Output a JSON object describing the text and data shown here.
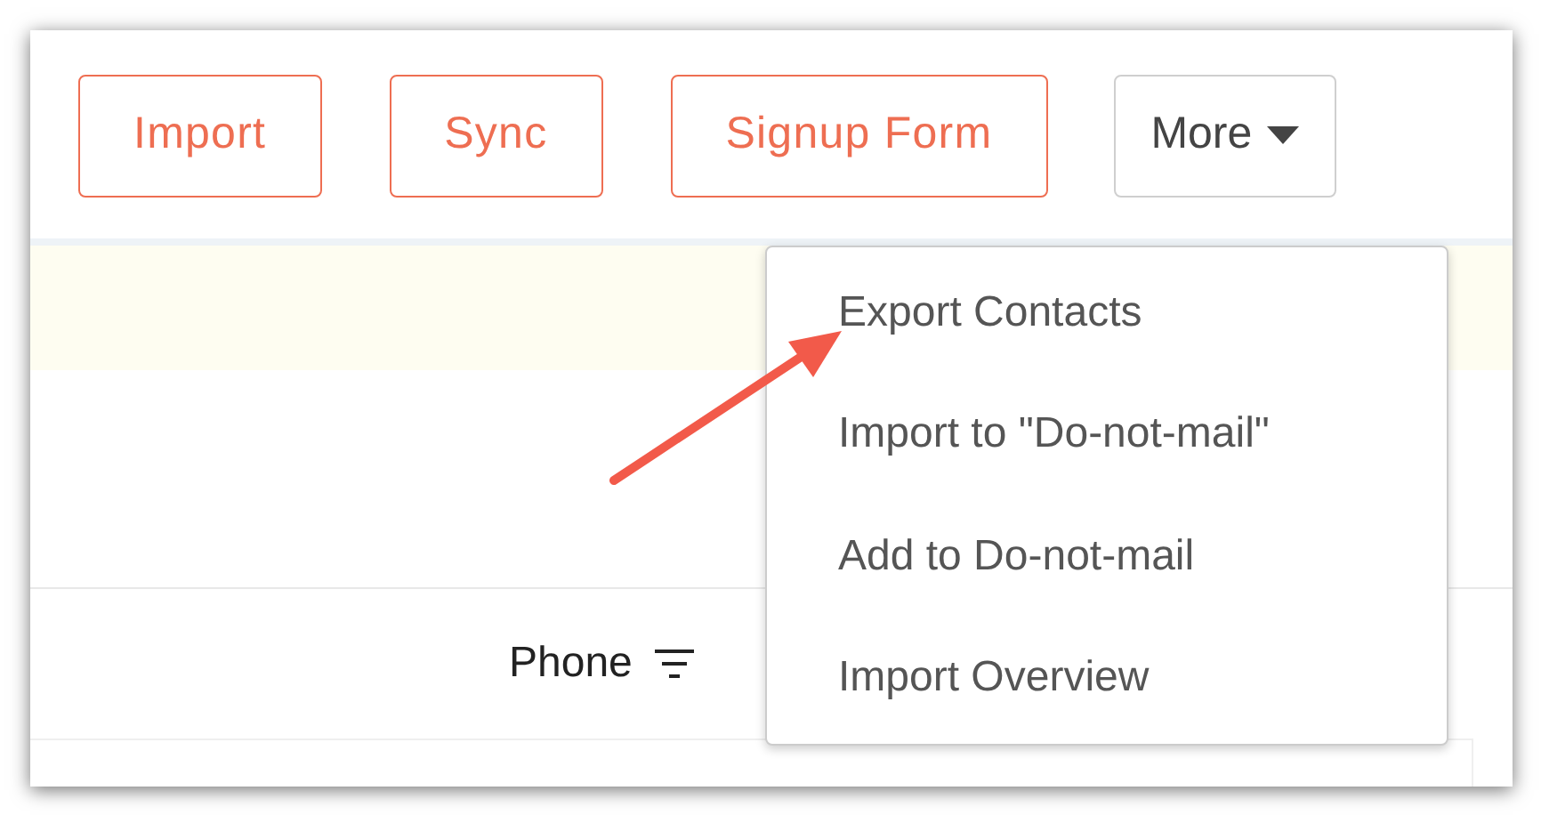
{
  "toolbar": {
    "buttons": [
      {
        "label": "Import",
        "kind": "primary"
      },
      {
        "label": "Sync",
        "kind": "primary"
      },
      {
        "label": "Signup Form",
        "kind": "primary"
      },
      {
        "label": "More",
        "kind": "dropdown"
      }
    ]
  },
  "table": {
    "columns": [
      "Phone"
    ]
  },
  "more_menu": {
    "items": [
      "Export Contacts",
      "Import to \"Do-not-mail\"",
      "Add to Do-not-mail",
      "Import Overview"
    ]
  }
}
